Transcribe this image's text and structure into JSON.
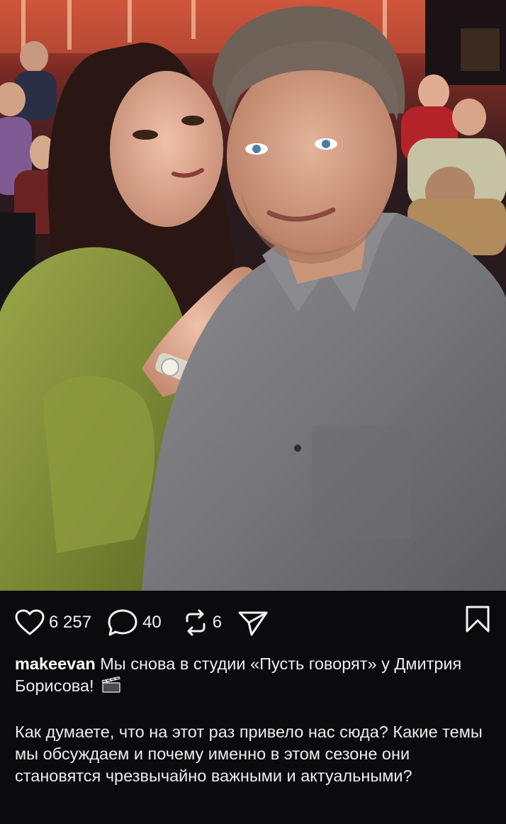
{
  "post": {
    "image": {
      "alt": "",
      "icon": "selfie-photo"
    },
    "likes": "6 257",
    "comments": "40",
    "reposts": "6",
    "username": "makeevan",
    "caption_line1": "Мы снова в студии «Пусть говорят» у Дмитрия Борисова!",
    "caption_emoji": "clapper-board-icon",
    "caption_paragraph2": "Как думаете, что на этот раз привело нас сюда? Какие темы мы обсуждаем и почему именно в этом сезоне они становятся чрезвычайно важными и актуальными?"
  },
  "icons": {
    "like": "heart-outline-icon",
    "comment": "comment-bubble-icon",
    "repost": "repost-icon",
    "share": "send-icon",
    "save": "bookmark-icon"
  },
  "colors": {
    "background": "#0b0b0d",
    "text": "#f2f2f2"
  }
}
